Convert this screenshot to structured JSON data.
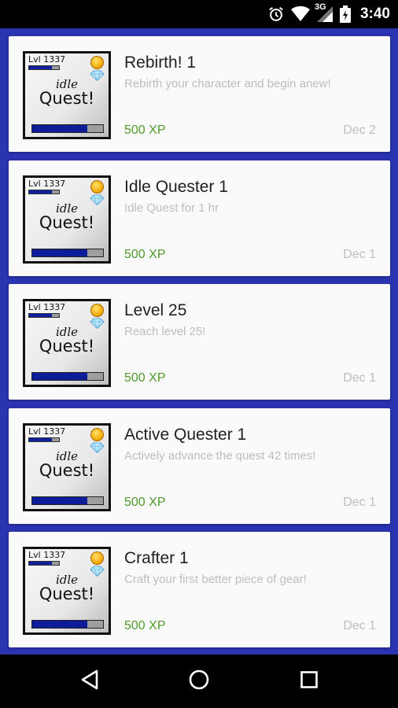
{
  "status_bar": {
    "time": "3:40",
    "network": "3G",
    "icons": [
      "alarm-icon",
      "wifi-icon",
      "signal-icon",
      "battery-charging-icon"
    ]
  },
  "thumbnail": {
    "level_text": "Lvl 1337",
    "logo_line1": "idle",
    "logo_line2": "Quest!",
    "icons": [
      "coin-icon",
      "diamond-icon"
    ],
    "xp_fraction": 0.75,
    "progress_fraction": 0.78
  },
  "achievements": [
    {
      "title": "Rebirth! 1",
      "description": "Rebirth your character and begin anew!",
      "xp": "500 XP",
      "date": "Dec 2"
    },
    {
      "title": "Idle Quester 1",
      "description": "Idle Quest for 1 hr",
      "xp": "500 XP",
      "date": "Dec 1"
    },
    {
      "title": "Level 25",
      "description": "Reach level 25!",
      "xp": "500 XP",
      "date": "Dec 1"
    },
    {
      "title": "Active Quester 1",
      "description": "Actively advance the quest 42 times!",
      "xp": "500 XP",
      "date": "Dec 1"
    },
    {
      "title": "Crafter 1",
      "description": "Craft your first better piece of gear!",
      "xp": "500 XP",
      "date": "Dec 1"
    }
  ],
  "nav": {
    "icons": [
      "back-icon",
      "home-icon",
      "recents-icon"
    ]
  },
  "colors": {
    "background": "#2a33b0",
    "xp_text": "#4f9a2b",
    "muted_text": "#bdbdbd",
    "progress_fill": "#0d1d9a"
  }
}
